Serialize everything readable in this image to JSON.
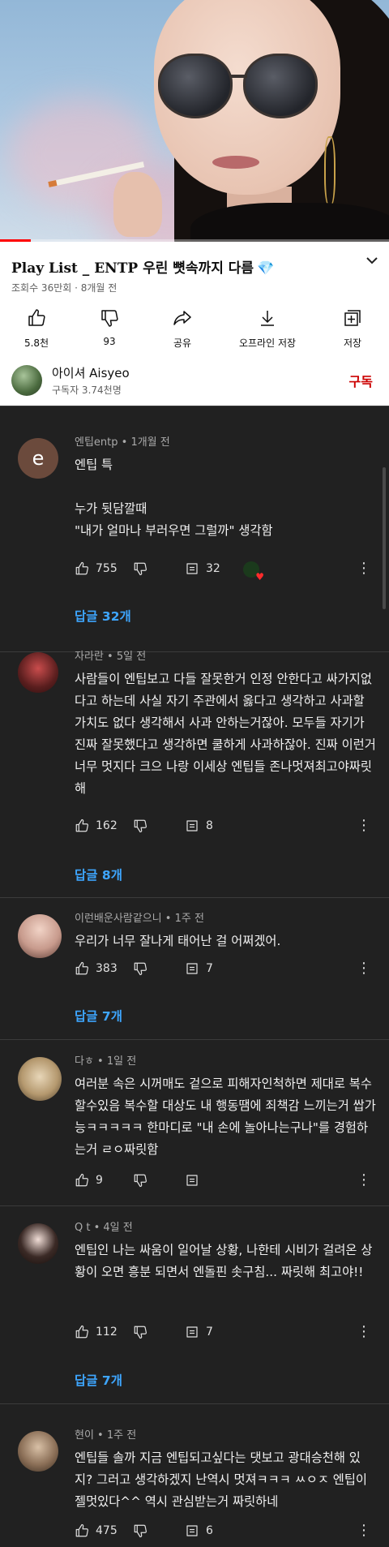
{
  "video": {
    "title": "Play List _ ENTP 우린 뼛속까지 다름",
    "title_emoji": "💎",
    "meta": "조회수 36만회 · 8개월 전",
    "progress_fraction": 0.08
  },
  "actions": [
    {
      "icon": "thumbs-up-icon",
      "label": "5.8천"
    },
    {
      "icon": "thumbs-down-icon",
      "label": "93"
    },
    {
      "icon": "share-icon",
      "label": "공유"
    },
    {
      "icon": "download-icon",
      "label": "오프라인 저장"
    },
    {
      "icon": "save-playlist-icon",
      "label": "저장"
    }
  ],
  "channel": {
    "name": "아이셔 Aisyeo",
    "subscribers": "구독자 3.74천명",
    "subscribe_label": "구독"
  },
  "comments": [
    {
      "author": "엔팁entp",
      "time": "1개월 전",
      "avatar_letter": "e",
      "text": "엔팁 특\n\n누가 뒷담깔때\n\"내가 얼마나 부러우면 그럴까\" 생각함",
      "likes": "755",
      "reply_count": "32",
      "replies_label": "답글 32개"
    },
    {
      "author": "자라란",
      "time": "5일 전",
      "text": "사람들이 엔팁보고 다들 잘못한거 인정 안한다고 싸가지없다고 하는데 사실 자기 주관에서 옳다고 생각하고 사과할 가치도 없다 생각해서 사과 안하는거잖아. 모두들 자기가 진짜 잘못했다고 생각하면 쿨하게 사과하잖아. 진짜 이런거 너무 멋지다 크으 나랑 이세상 엔팁들 존나멋져최고야짜릿해",
      "likes": "162",
      "reply_count": "8",
      "replies_label": "답글 8개"
    },
    {
      "author": "이런배운사람같으니",
      "time": "1주 전",
      "text": "우리가 너무 잘나게 태어난 걸 어쩌겠어.",
      "likes": "383",
      "reply_count": "7",
      "replies_label": "답글 7개"
    },
    {
      "author": "다ㅎ",
      "time": "1일 전",
      "text": "여러분 속은 시꺼매도 겉으로 피해자인척하면 제대로 복수할수있음 복수할 대상도 내 행동땜에 죄책감 느끼는거 쌉가능ㅋㅋㅋㅋㅋ 한마디로 \"내 손에 놀아나는구나\"를 경험하는거 ㄹㅇ짜릿함",
      "likes": "9",
      "reply_count": "",
      "replies_label": ""
    },
    {
      "author": "Q t",
      "time": "4일 전",
      "text": "엔팁인 나는 싸움이 일어날 상황, 나한테 시비가 걸려온 상황이 오면 흥분 되면서 엔돌핀 솟구침... 짜릿해 최고야!!",
      "likes": "112",
      "reply_count": "7",
      "replies_label": "답글 7개"
    },
    {
      "author": "현이",
      "time": "1주 전",
      "text": "엔팁들 솔까 지금 엔팁되고싶다는 댓보고 광대승천해 있지? 그러고 생각하겠지 난역시 멋져ㅋㅋㅋ ㅆㅇㅈ 엔팁이 젤멋있다^^ 역시 관심받는거 짜릿하네",
      "likes": "475",
      "reply_count": "6",
      "replies_label": ""
    }
  ]
}
